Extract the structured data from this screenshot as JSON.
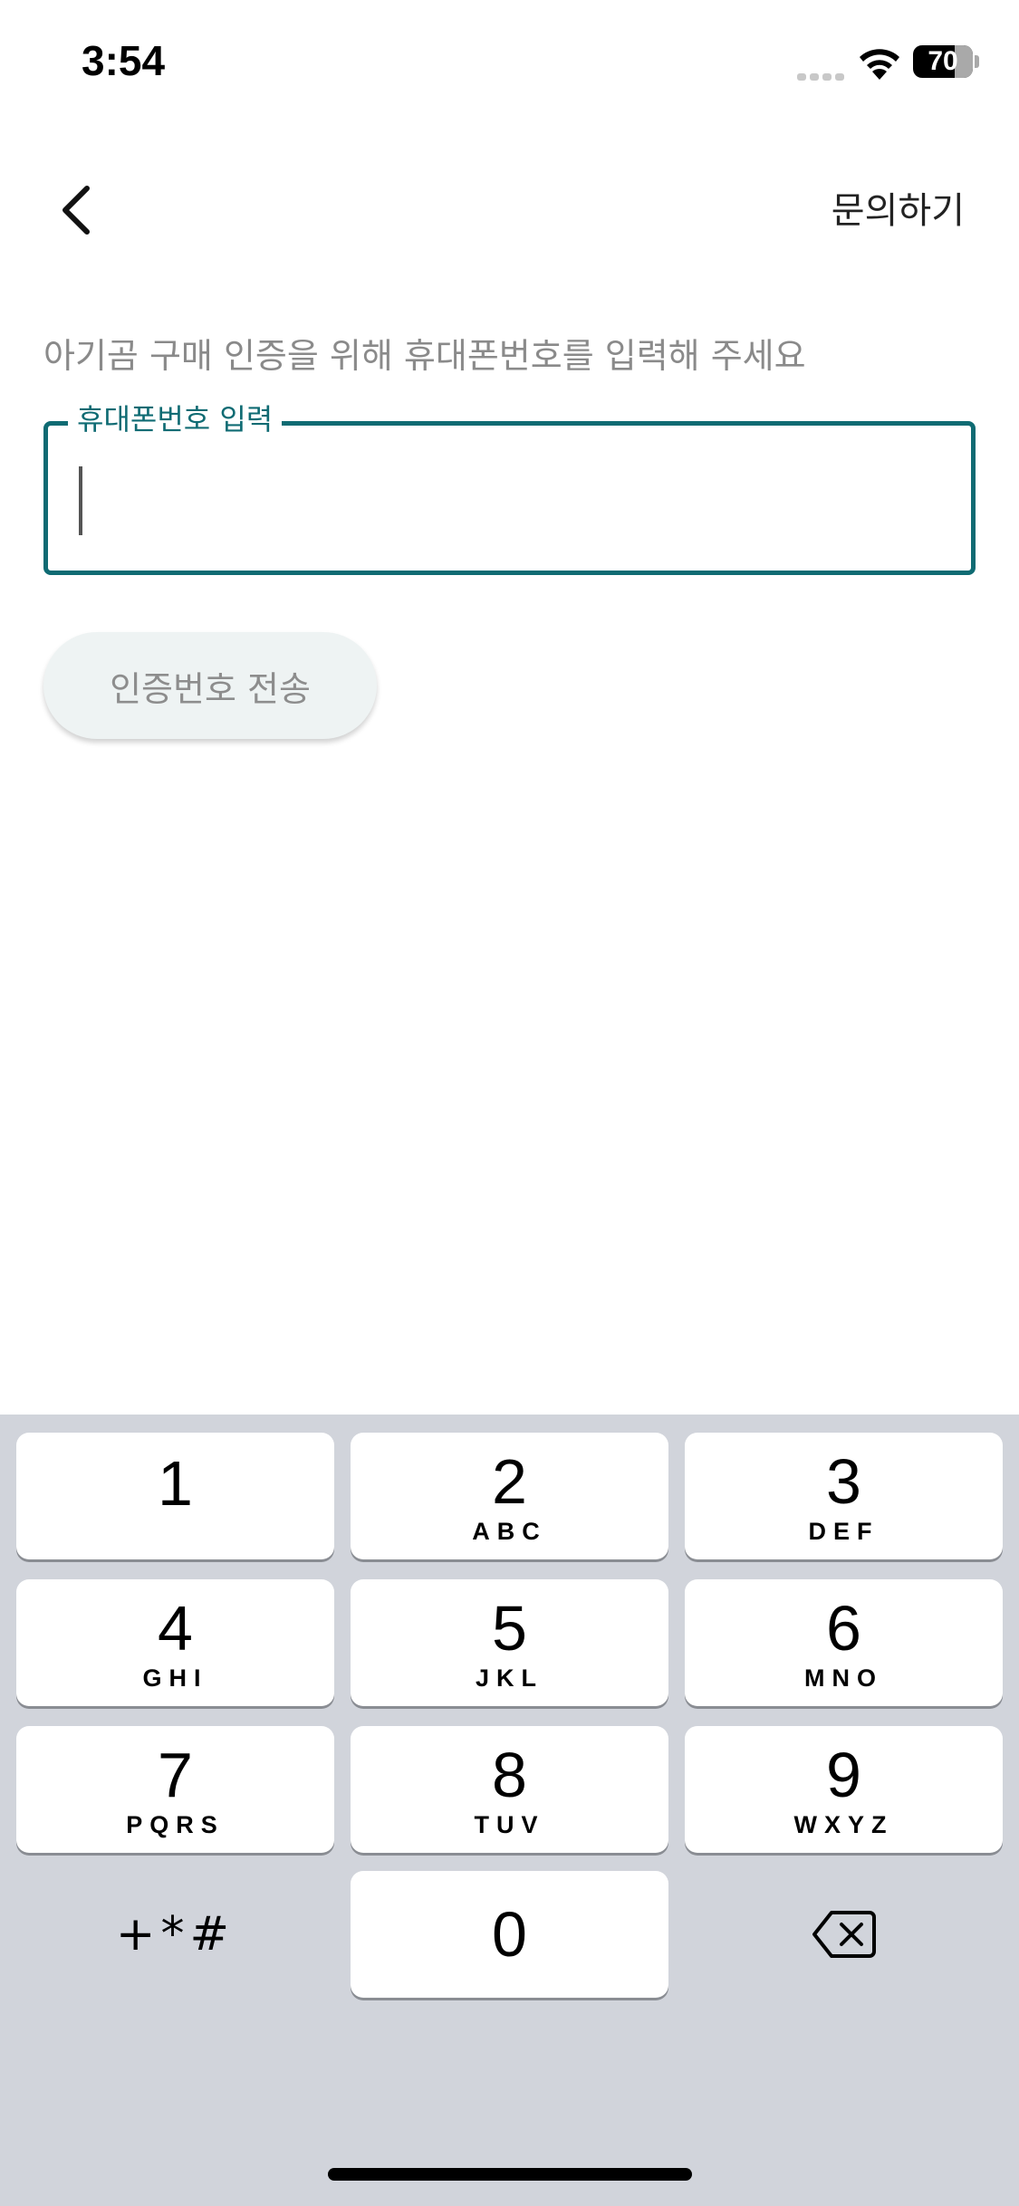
{
  "status_bar": {
    "time": "3:54",
    "battery_percent": "70",
    "battery_level": 0.7,
    "icons": [
      "cellular-signal-icon",
      "wifi-icon",
      "battery-icon"
    ]
  },
  "header": {
    "back_icon": "chevron-left-icon",
    "inquiry_label": "문의하기"
  },
  "main": {
    "instruction": "아기곰 구매 인증을 위해 휴대폰번호를 입력해 주세요",
    "phone_field": {
      "label": "휴대폰번호 입력",
      "value": ""
    },
    "send_code_label": "인증번호 전송"
  },
  "keypad": {
    "keys": [
      {
        "digit": "1",
        "letters": ""
      },
      {
        "digit": "2",
        "letters": "ABC"
      },
      {
        "digit": "3",
        "letters": "DEF"
      },
      {
        "digit": "4",
        "letters": "GHI"
      },
      {
        "digit": "5",
        "letters": "JKL"
      },
      {
        "digit": "6",
        "letters": "MNO"
      },
      {
        "digit": "7",
        "letters": "PQRS"
      },
      {
        "digit": "8",
        "letters": "TUV"
      },
      {
        "digit": "9",
        "letters": "WXYZ"
      }
    ],
    "symbols_label": "+*#",
    "zero": "0",
    "delete_icon": "backspace-icon"
  },
  "colors": {
    "accent": "#0f6b73",
    "keypad_background": "#d1d4db",
    "button_background": "#eef3f3",
    "hint_text": "#8a8a8a"
  }
}
